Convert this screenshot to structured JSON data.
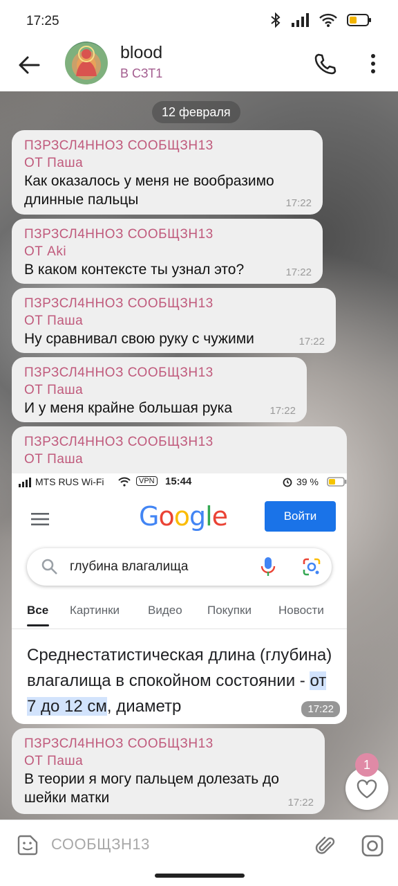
{
  "status": {
    "time": "17:25"
  },
  "chat": {
    "title": "blood",
    "subtitle": "В СЗТ1"
  },
  "date_label": "12 февраля",
  "messages": [
    {
      "tag": "ПЗРЗСЛ4ННОЗ СООБЩЗН13",
      "from": "ОТ Паша",
      "text": "Как оказалось у меня не вообразимо длинные пальцы",
      "time": "17:22"
    },
    {
      "tag": "ПЗРЗСЛ4ННОЗ СООБЩЗН13",
      "from": "ОТ Aki",
      "text": "В каком контексте ты узнал это?",
      "time": "17:22"
    },
    {
      "tag": "ПЗРЗСЛ4ННОЗ СООБЩЗН13",
      "from": "ОТ Паша",
      "text": "Ну сравнивал свою руку с чужими",
      "time": "17:22"
    },
    {
      "tag": "ПЗРЗСЛ4ННОЗ СООБЩЗН13",
      "from": "ОТ Паша",
      "text": "И у меня крайне большая рука",
      "time": "17:22"
    },
    {
      "tag": "ПЗРЗСЛ4ННОЗ СООБЩЗН13",
      "from": "ОТ Паша",
      "time": "17:22"
    },
    {
      "tag": "ПЗРЗСЛ4ННОЗ СООБЩЗН13",
      "from": "ОТ Паша",
      "text": "В теории я могу пальцем долезать до шейки матки",
      "time": "17:22"
    }
  ],
  "screenshot": {
    "carrier": "MTS RUS Wi-Fi",
    "vpn": "VPN",
    "time": "15:44",
    "battery": "39 %",
    "login": "Войти",
    "query": "глубина влагалища",
    "tabs": [
      "Все",
      "Картинки",
      "Видео",
      "Покупки",
      "Новости"
    ],
    "result_pre": "Среднестатистическая длина (глубина) влагалища в спокойном состоянии - ",
    "result_hl": "от 7 до 12 см",
    "result_post": ", диаметр"
  },
  "reactions": {
    "count": "1"
  },
  "input": {
    "placeholder": "СООБЩЗН13"
  }
}
